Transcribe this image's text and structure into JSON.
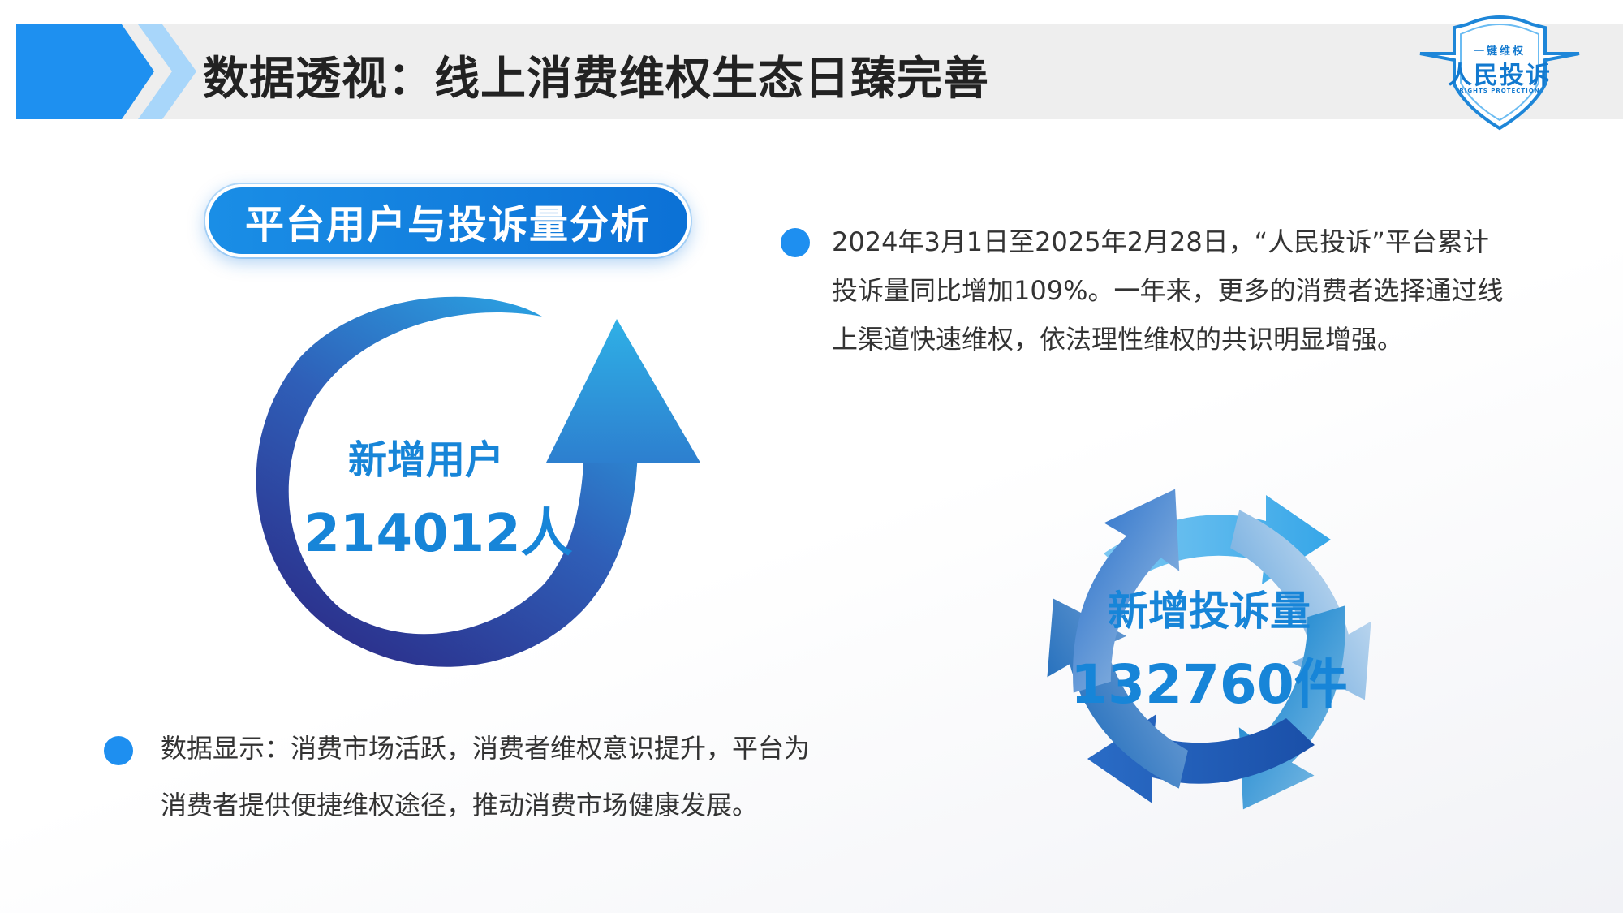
{
  "header": {
    "title": "数据透视：线上消费维权生态日臻完善"
  },
  "logo": {
    "top_text": "一键维权",
    "main_text": "人民投诉",
    "sub_text": "RIGHTS PROTECTION"
  },
  "section": {
    "title": "平台用户与投诉量分析"
  },
  "users": {
    "label": "新增用户",
    "value": "214012人"
  },
  "complaints": {
    "label": "新增投诉量",
    "value": "132760件"
  },
  "paragraph_top": {
    "lines": [
      "2024年3月1日至2025年2月28日，“人民投诉”平台累计",
      "投诉量同比增加109%。一年来，更多的消费者选择通过线",
      "上渠道快速维权，依法理性维权的共识明显增强。"
    ]
  },
  "paragraph_bottom": {
    "lines": [
      "数据显示：消费市场活跃，消费者维权意识提升，平台为",
      "消费者提供便捷维权途径，推动消费市场健康发展。"
    ]
  },
  "colors": {
    "accent": "#1e8ff0",
    "primary_blue": "#1785d8",
    "deep_blue": "#2a2f8f",
    "header_bg": "#eeeeee"
  }
}
